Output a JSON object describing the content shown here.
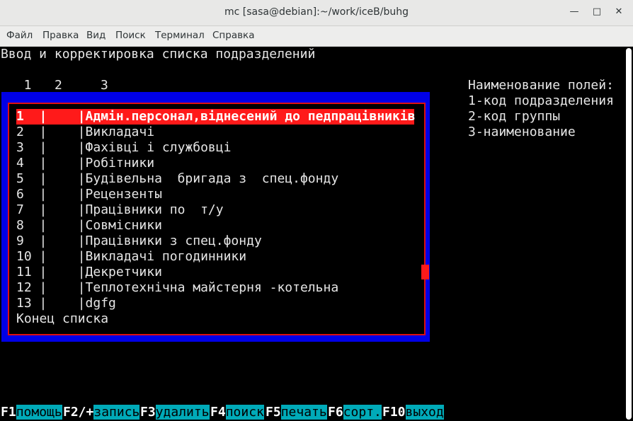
{
  "window": {
    "title": "mc [sasa@debian]:~/work/iceB/buhg",
    "minimize_icon": "minimize-icon",
    "maximize_icon": "maximize-icon",
    "close_icon": "close-icon"
  },
  "menubar": [
    "Файл",
    "Правка",
    "Вид",
    "Поиск",
    "Терминал",
    "Справка"
  ],
  "screen": {
    "heading": "Ввод и корректировка списка подразделений",
    "column_numbers": "  1   2     3",
    "field_legend": [
      "Наименование полей:",
      "1-код подразделения",
      "2-код группы",
      "3-наименование"
    ]
  },
  "list": {
    "rows": [
      "1  |    |Адмін.персонал,віднесений до педпрацівників",
      "2  |    |Викладачі",
      "3  |    |Фахівці і службовці",
      "4  |    |Робітники",
      "5  |    |Будівельна  бригада з  спец.фонду",
      "6  |    |Рецензенты",
      "7  |    |Працівники по  т/у",
      "8  |    |Совмісники",
      "9  |    |Працівники з спец.фонду",
      "10 |    |Викладачі погодинники",
      "11 |    |Декретчики",
      "12 |    |Теплотехнічна майстерня -котельна",
      "13 |    |dgfg"
    ],
    "end_label": "Конец списка",
    "selected_index": 0
  },
  "function_keys": [
    {
      "key": "F1",
      "label": "помощь"
    },
    {
      "key": "F2/+",
      "label": "запись"
    },
    {
      "key": "F3",
      "label": "удалить"
    },
    {
      "key": "F4",
      "label": "поиск"
    },
    {
      "key": "F5",
      "label": "печать"
    },
    {
      "key": "F6",
      "label": "сорт."
    },
    {
      "key": "F10",
      "label": "выход"
    }
  ],
  "colors": {
    "frame_blue": "#0000e6",
    "selection_red": "#ff1a1a",
    "fkey_label_bg": "#00aab8"
  }
}
